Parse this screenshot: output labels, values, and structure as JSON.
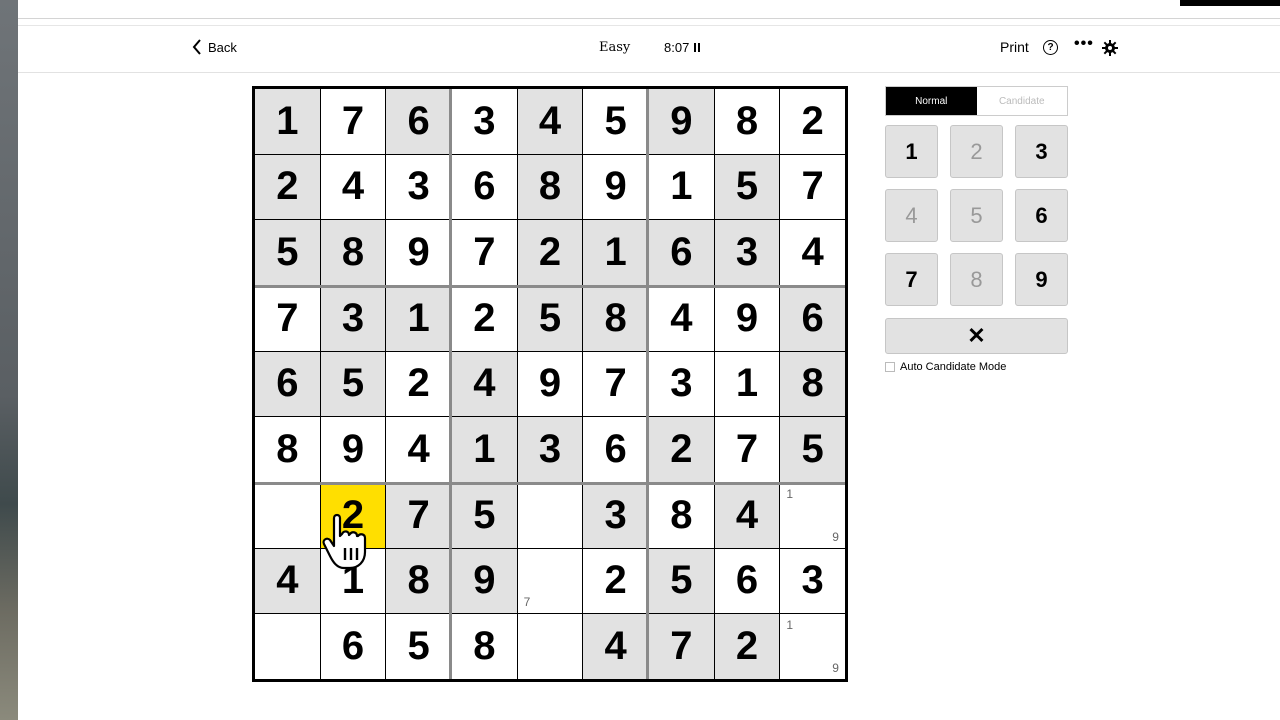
{
  "header": {
    "back_label": "Back",
    "difficulty": "Easy",
    "timer": "8:07",
    "print_label": "Print",
    "help_label": "?",
    "more_label": "•••"
  },
  "board": {
    "rows": [
      [
        "1",
        "7",
        "6",
        "3",
        "4",
        "5",
        "9",
        "8",
        "2"
      ],
      [
        "2",
        "4",
        "3",
        "6",
        "8",
        "9",
        "1",
        "5",
        "7"
      ],
      [
        "5",
        "8",
        "9",
        "7",
        "2",
        "1",
        "6",
        "3",
        "4"
      ],
      [
        "7",
        "3",
        "1",
        "2",
        "5",
        "8",
        "4",
        "9",
        "6"
      ],
      [
        "6",
        "5",
        "2",
        "4",
        "9",
        "7",
        "3",
        "1",
        "8"
      ],
      [
        "8",
        "9",
        "4",
        "1",
        "3",
        "6",
        "2",
        "7",
        "5"
      ],
      [
        "",
        "2",
        "7",
        "5",
        "",
        "3",
        "8",
        "4",
        ""
      ],
      [
        "4",
        "1",
        "8",
        "9",
        "",
        "2",
        "5",
        "6",
        "3"
      ],
      [
        "",
        "6",
        "5",
        "8",
        "",
        "4",
        "7",
        "2",
        ""
      ]
    ],
    "candidates": {
      "6-8-tl": "1",
      "6-8-br": "9",
      "7-4-bl": "7",
      "8-8-tl": "1",
      "8-8-br": "9"
    }
  },
  "controls": {
    "mode_normal": "Normal",
    "mode_candidate": "Candidate",
    "keys": [
      "1",
      "2",
      "3",
      "4",
      "5",
      "6",
      "7",
      "8",
      "9"
    ],
    "erase_label": "✕",
    "auto_candidate_label": "Auto Candidate Mode"
  }
}
